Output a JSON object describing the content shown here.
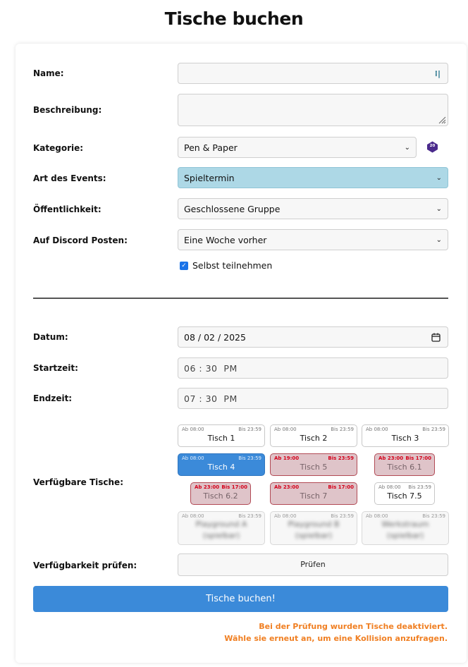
{
  "page": {
    "title": "Tische buchen"
  },
  "form": {
    "name": {
      "label": "Name:",
      "value": ""
    },
    "beschreibung": {
      "label": "Beschreibung:",
      "value": ""
    },
    "kategorie": {
      "label": "Kategorie:",
      "value": "Pen & Paper",
      "badge": "20"
    },
    "art": {
      "label": "Art des Events:",
      "value": "Spieltermin",
      "highlight_color": "#add8e6"
    },
    "oeffentlichkeit": {
      "label": "Öffentlichkeit:",
      "value": "Geschlossene Gruppe"
    },
    "discord": {
      "label": "Auf Discord Posten:",
      "value": "Eine Woche vorher"
    },
    "selbst": {
      "label": "Selbst teilnehmen",
      "checked": true
    }
  },
  "datetime": {
    "datum": {
      "label": "Datum:",
      "value": "08 / 02 / 2025"
    },
    "startzeit": {
      "label": "Startzeit:",
      "value": "06 : 30  PM"
    },
    "endzeit": {
      "label": "Endzeit:",
      "value": "07 : 30  PM"
    }
  },
  "tables": {
    "label": "Verfügbare Tische:",
    "items": [
      {
        "ab": "Ab 08:00",
        "bis": "Bis 23:59",
        "name": "Tisch 1",
        "state": "free"
      },
      {
        "ab": "Ab 08:00",
        "bis": "Bis 23:59",
        "name": "Tisch 2",
        "state": "free"
      },
      {
        "ab": "Ab 08:00",
        "bis": "Bis 23:59",
        "name": "Tisch 3",
        "state": "free"
      },
      {
        "ab": "Ab 08:00",
        "bis": "Bis 23:59",
        "name": "Tisch 4",
        "state": "selected"
      },
      {
        "ab": "Ab 19:00",
        "bis": "Bis 23:59",
        "name": "Tisch 5",
        "state": "conflict"
      },
      {
        "ab": "Ab 23:00",
        "bis": "Bis 17:00",
        "name": "Tisch 6.1",
        "state": "conflict"
      },
      {
        "ab": "Ab 23:00",
        "bis": "Bis 17:00",
        "name": "Tisch 6.2",
        "state": "conflict"
      },
      {
        "ab": "Ab 23:00",
        "bis": "Bis 17:00",
        "name": "Tisch 7",
        "state": "conflict"
      },
      {
        "ab": "Ab 08:00",
        "bis": "Bis 23:59",
        "name": "Tisch 7.5",
        "state": "free"
      },
      {
        "ab": "Ab 08:00",
        "bis": "Bis 23:59",
        "name": "Playground A (spielbar)",
        "state": "disabled"
      },
      {
        "ab": "Ab 08:00",
        "bis": "Bis 23:59",
        "name": "Playground B (spielbar)",
        "state": "disabled"
      },
      {
        "ab": "Ab 08:00",
        "bis": "Bis 23:59",
        "name": "Werkstraum (spielbar)",
        "state": "disabled"
      }
    ]
  },
  "check": {
    "label": "Verfügbarkeit prüfen:",
    "button": "Prüfen"
  },
  "submit": {
    "label": "Tische buchen!"
  },
  "warning": {
    "line1": "Bei der Prüfung wurden Tische deaktiviert.",
    "line2": "Wähle sie erneut an, um eine Kollision anzufragen.",
    "color": "#f07f22"
  },
  "colors": {
    "primary": "#3b8ad9",
    "conflict_bg": "#dfc4c9",
    "conflict_text": "#d4001a"
  }
}
